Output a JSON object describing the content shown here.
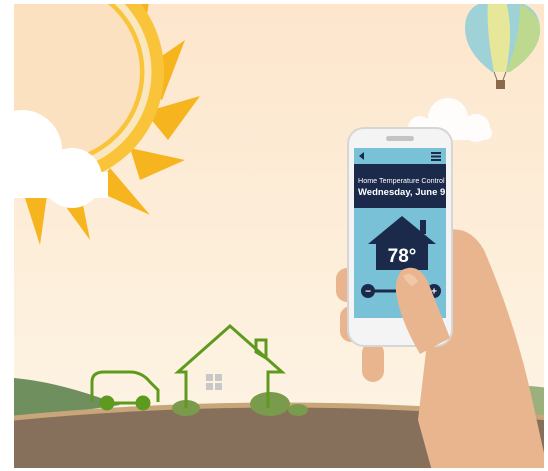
{
  "app": {
    "title": "Home Temperature Control",
    "date": "Wednesday, June 9"
  },
  "thermostat": {
    "temperature": "78°",
    "slider_minus": "−",
    "slider_plus": "+"
  },
  "icons": {
    "back": "back-arrow-icon",
    "menu": "hamburger-menu-icon",
    "house": "house-icon"
  },
  "colors": {
    "sky_top": "#fde8cf",
    "sky_bottom": "#fdf4e3",
    "sun": "#f6b51f",
    "ground": "#86705c",
    "ground_edge": "#c9a57a",
    "outline_green": "#5e9a1e",
    "bush_green": "#7a9a4c",
    "hill_green": "#6f8f5e",
    "screen": "#79c1d6",
    "header_navy": "#1b2a4a",
    "skin": "#e8b58e"
  }
}
